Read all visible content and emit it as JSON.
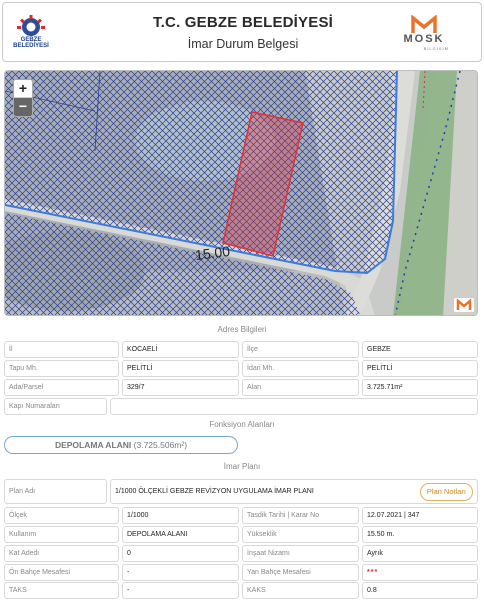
{
  "header": {
    "title": "T.C. GEBZE BELEDİYESİ",
    "subtitle": "İmar Durum Belgesi",
    "left_logo_text": "GEBZE BELEDİYESİ",
    "right_logo_text": "MOSK",
    "right_logo_sub": "BİLGİSİM"
  },
  "map": {
    "zoom_in": "+",
    "zoom_out": "−",
    "road_label": "15.00"
  },
  "address": {
    "section_title": "Adres Bilgileri",
    "rows": [
      [
        {
          "label": "İl",
          "value": "KOCAELİ"
        },
        {
          "label": "İlçe",
          "value": "GEBZE"
        }
      ],
      [
        {
          "label": "Tapu Mh.",
          "value": "PELİTLİ"
        },
        {
          "label": "İdari Mh.",
          "value": "PELİTLİ"
        }
      ],
      [
        {
          "label": "Ada/Parsel",
          "value": "329/7"
        },
        {
          "label": "Alan",
          "value": "3.725.71m²"
        }
      ]
    ],
    "door_label": "Kapı Numaraları",
    "door_value": ""
  },
  "function": {
    "section_title": "Fonksiyon Alanları",
    "name": "DEPOLAMA ALANI",
    "area": "(3.725.506m²)"
  },
  "plan": {
    "section_title": "İmar Planı",
    "plan_name_label": "Plan Adı",
    "plan_name_value": "1/1000 ÖLÇEKLİ GEBZE REVİZYON UYGULAMA İMAR PLANI",
    "plan_notes_button": "Plan Notları",
    "rows": [
      [
        {
          "label": "Ölçek",
          "value": "1/1000"
        },
        {
          "label": "Tasdik Tarihi | Karar No",
          "value": "12.07.2021 | 347"
        }
      ],
      [
        {
          "label": "Kullanım",
          "value": "DEPOLAMA ALANI"
        },
        {
          "label": "Yükseklik",
          "value": "15.50 m."
        }
      ],
      [
        {
          "label": "Kat Adedi",
          "value": "0"
        },
        {
          "label": "İnşaat Nizamı",
          "value": "Ayrık"
        }
      ],
      [
        {
          "label": "Ön Bahçe Mesafesi",
          "value": "-"
        },
        {
          "label": "Yan Bahçe Mesafesi",
          "value": "***"
        }
      ],
      [
        {
          "label": "TAKS",
          "value": "-"
        },
        {
          "label": "KAKS",
          "value": "0.8"
        }
      ]
    ]
  },
  "colors": {
    "hatch": "#2a3f96",
    "parcel": "#e0303a",
    "boundary": "#3b7be0",
    "accent": "#e3b15e"
  }
}
